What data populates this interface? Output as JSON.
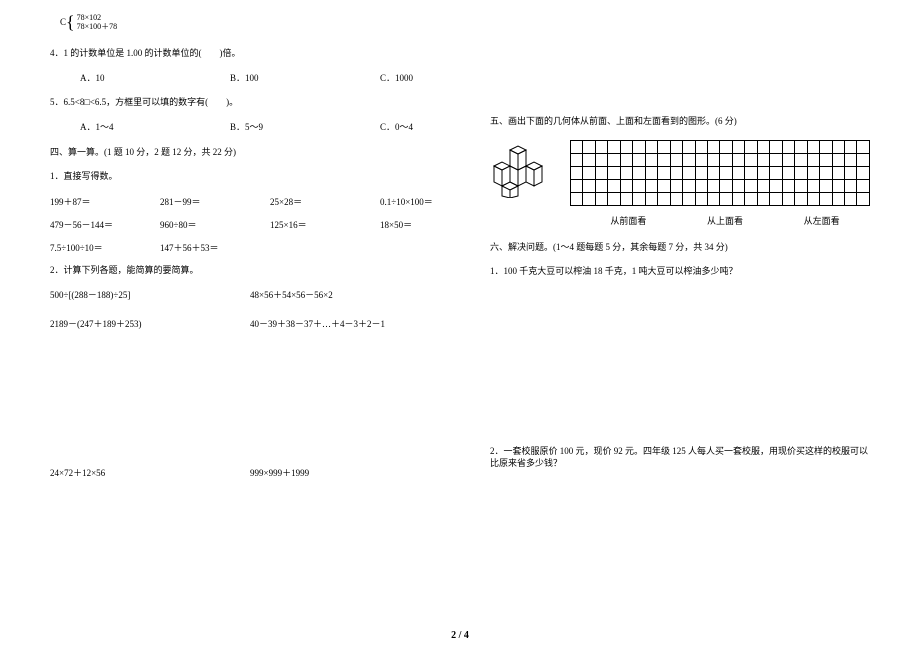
{
  "left": {
    "optionC": {
      "letter": "C",
      "line1": "78×102",
      "line2": "78×100＋78"
    },
    "q4": {
      "text": "4．1 的计数单位是 1.00 的计数单位的(　　)倍。",
      "a": "A．10",
      "b": "B．100",
      "c": "C．1000"
    },
    "q5": {
      "text": "5．6.5<8□<6.5，方框里可以填的数字有(　　)。",
      "a": "A．1～4",
      "b": "B．5～9",
      "c": "C．0～4"
    },
    "section4": "四、算一算。(1 题 10 分，2 题 12 分，共 22 分)",
    "q1": {
      "text": "1．直接写得数。",
      "r1c1": "199＋87＝",
      "r1c2": "281－99＝",
      "r1c3": "25×28＝",
      "r1c4": "0.1÷10×100＝",
      "r2c1": "479－56－144＝",
      "r2c2": "960÷80＝",
      "r2c3": "125×16＝",
      "r2c4": "18×50＝",
      "r3c1": "7.5÷100÷10＝",
      "r3c2": "147＋56＋53＝"
    },
    "q2": {
      "text": "2．计算下列各题，能简算的要简算。",
      "p1a": "500÷[(288－188)÷25]",
      "p1b": "48×56＋54×56－56×2",
      "p2a": "2189－(247＋189＋253)",
      "p2b": "40－39＋38－37＋…＋4－3＋2－1",
      "p3a": "24×72＋12×56",
      "p3b": "999×999＋1999"
    }
  },
  "right": {
    "section5": "五、画出下面的几何体从前面、上面和左面看到的图形。(6 分)",
    "viewLabels": {
      "front": "从前面看",
      "top": "从上面看",
      "left": "从左面看"
    },
    "section6": "六、解决问题。(1～4 题每题 5 分，其余每题 7 分，共 34 分)",
    "q1": "1．100 千克大豆可以榨油 18 千克，1 吨大豆可以榨油多少吨？",
    "q2": "2．一套校服原价 100 元，现价 92 元。四年级 125 人每人买一套校服，用现价买这样的校服可以比原来省多少钱？"
  },
  "pageNumber": "2 / 4"
}
